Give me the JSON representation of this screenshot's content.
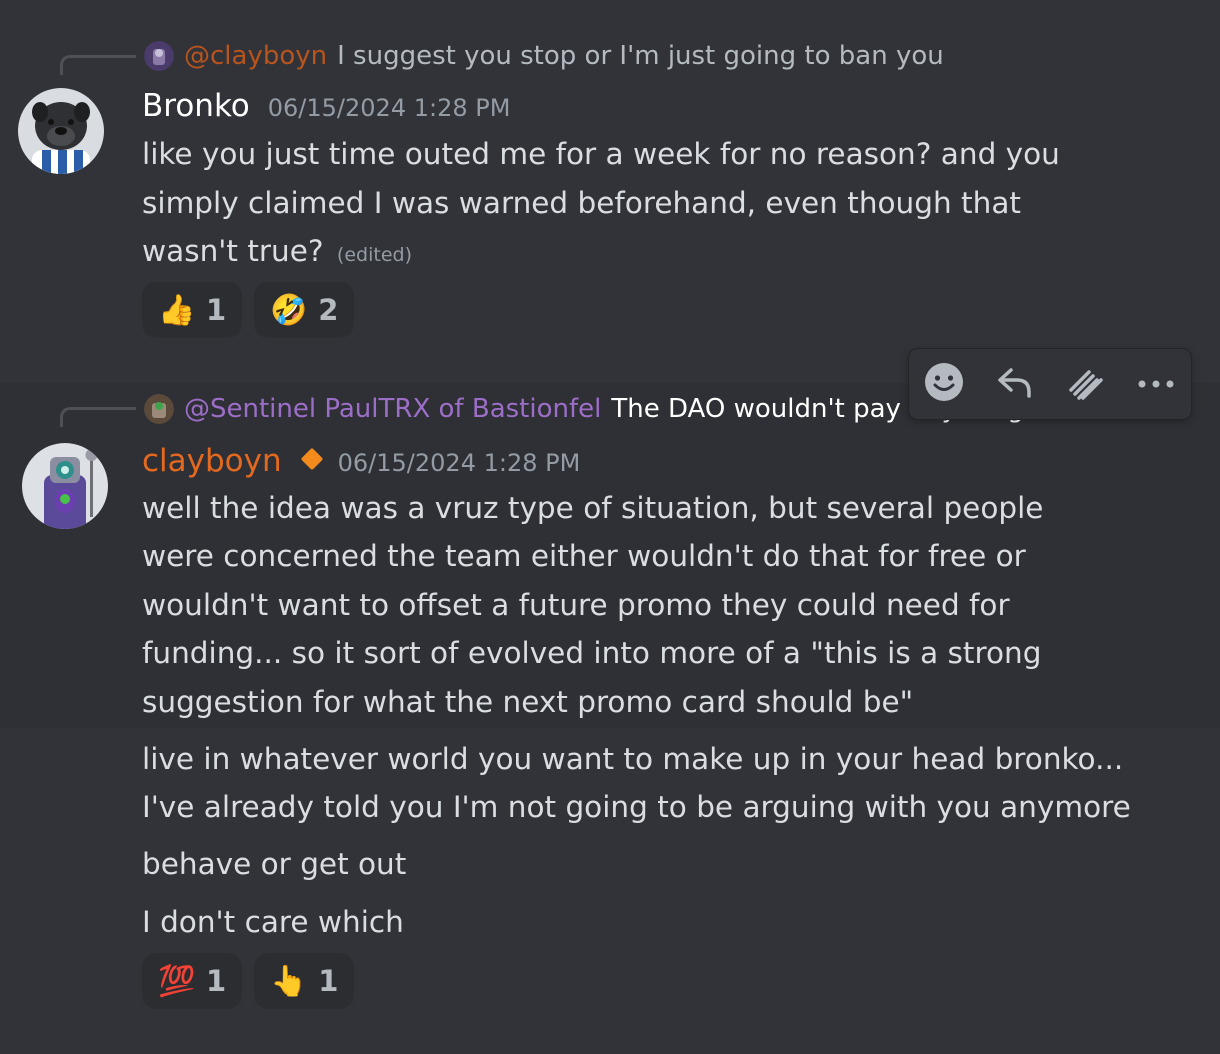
{
  "colors": {
    "background": "#313338",
    "bronko_name": "#ffffff",
    "clayboyn_name": "#e3691f",
    "sentinel_name": "#9d6ec8",
    "reply_clayboyn": "#b8541d",
    "role_icon": "#f48a1c",
    "text": "#dbdee1",
    "muted": "#949ba4"
  },
  "messages": [
    {
      "reply": {
        "author": "@clayboyn",
        "text": "I suggest you stop or I'm just going to ban you"
      },
      "author": "Bronko",
      "timestamp": "06/15/2024 1:28 PM",
      "lines": [
        "like you just time outed me for a week for no reason? and you",
        "simply claimed I was warned beforehand, even though that",
        "wasn't true?"
      ],
      "edited": "(edited)",
      "reactions": [
        {
          "emoji": "👍",
          "icon": "thumbs-up-emoji",
          "count": "1"
        },
        {
          "emoji": "🤣",
          "icon": "rolling-laughing-emoji",
          "count": "2"
        }
      ]
    },
    {
      "reply": {
        "author": "@Sentinel PaulTRX of Bastionfel",
        "text": "The DAO wouldn't pay anything, even"
      },
      "author": "clayboyn",
      "timestamp": "06/15/2024 1:28 PM",
      "lines": [
        "well the idea was a vruz type of situation, but several people",
        "were concerned the team either wouldn't do that for free or",
        "wouldn't want to offset a future promo they could need for",
        "funding... so it sort of evolved into more of a \"this is a strong",
        "suggestion for what the next promo card should be\""
      ]
    }
  ],
  "followups": [
    {
      "lines": [
        "live in whatever world you want to make up in your head bronko...",
        "I've already told you I'm not going to be arguing with you anymore"
      ]
    },
    {
      "lines": [
        "behave or get out"
      ]
    },
    {
      "lines": [
        "I don't care which"
      ]
    }
  ],
  "final_reactions": [
    {
      "emoji": "💯",
      "icon": "hundred-points-emoji",
      "count": "1"
    },
    {
      "emoji": "👆",
      "icon": "pointing-up-emoji",
      "count": "1"
    }
  ],
  "toolbar": {
    "buttons": [
      {
        "icon": "add-reaction-icon"
      },
      {
        "icon": "reply-icon"
      },
      {
        "icon": "forward-icon"
      },
      {
        "icon": "more-icon"
      }
    ]
  }
}
